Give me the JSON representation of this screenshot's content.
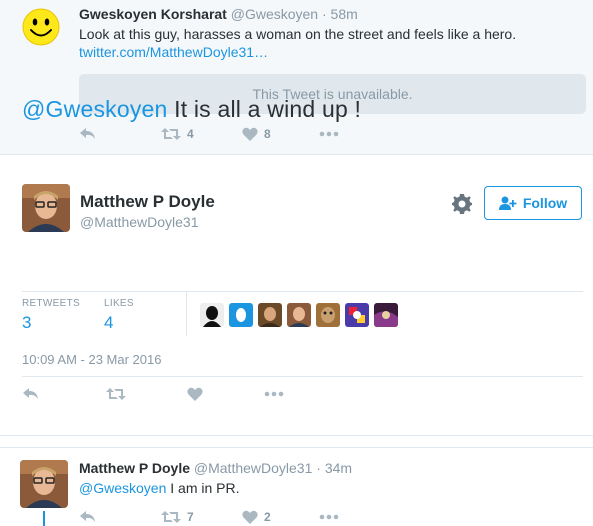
{
  "top_tweet": {
    "name": "Gweskoyen Korsharat",
    "handle": "@Gweskoyen",
    "time": "58m",
    "text": "Look at this guy, harasses a woman on the street and feels like a hero.",
    "link": "twitter.com/MatthewDoyle31…",
    "quoted_unavailable": "This Tweet is unavailable.",
    "retweets": "4",
    "likes": "8"
  },
  "main_tweet": {
    "name": "Matthew P Doyle",
    "handle": "@MatthewDoyle31",
    "follow_label": "Follow",
    "mention": "@Gweskoyen",
    "text": " It is all a wind up !",
    "retweets_label": "RETWEETS",
    "retweets_value": "3",
    "likes_label": "LIKES",
    "likes_value": "4",
    "timestamp": "10:09 AM - 23 Mar 2016"
  },
  "reply_tweet": {
    "name": "Matthew P Doyle",
    "handle": "@MatthewDoyle31",
    "time": "34m",
    "mention": "@Gweskoyen",
    "text": " I am in PR.",
    "retweets": "7",
    "likes": "2"
  },
  "colors": {
    "link": "#1b95e0",
    "muted": "#8899a6",
    "text": "#292f33",
    "background_alt": "#f5f8fa"
  },
  "icons": [
    "smiley-avatar",
    "reply-icon",
    "retweet-icon",
    "like-icon",
    "more-icon",
    "gear-icon",
    "follow-person-icon"
  ]
}
